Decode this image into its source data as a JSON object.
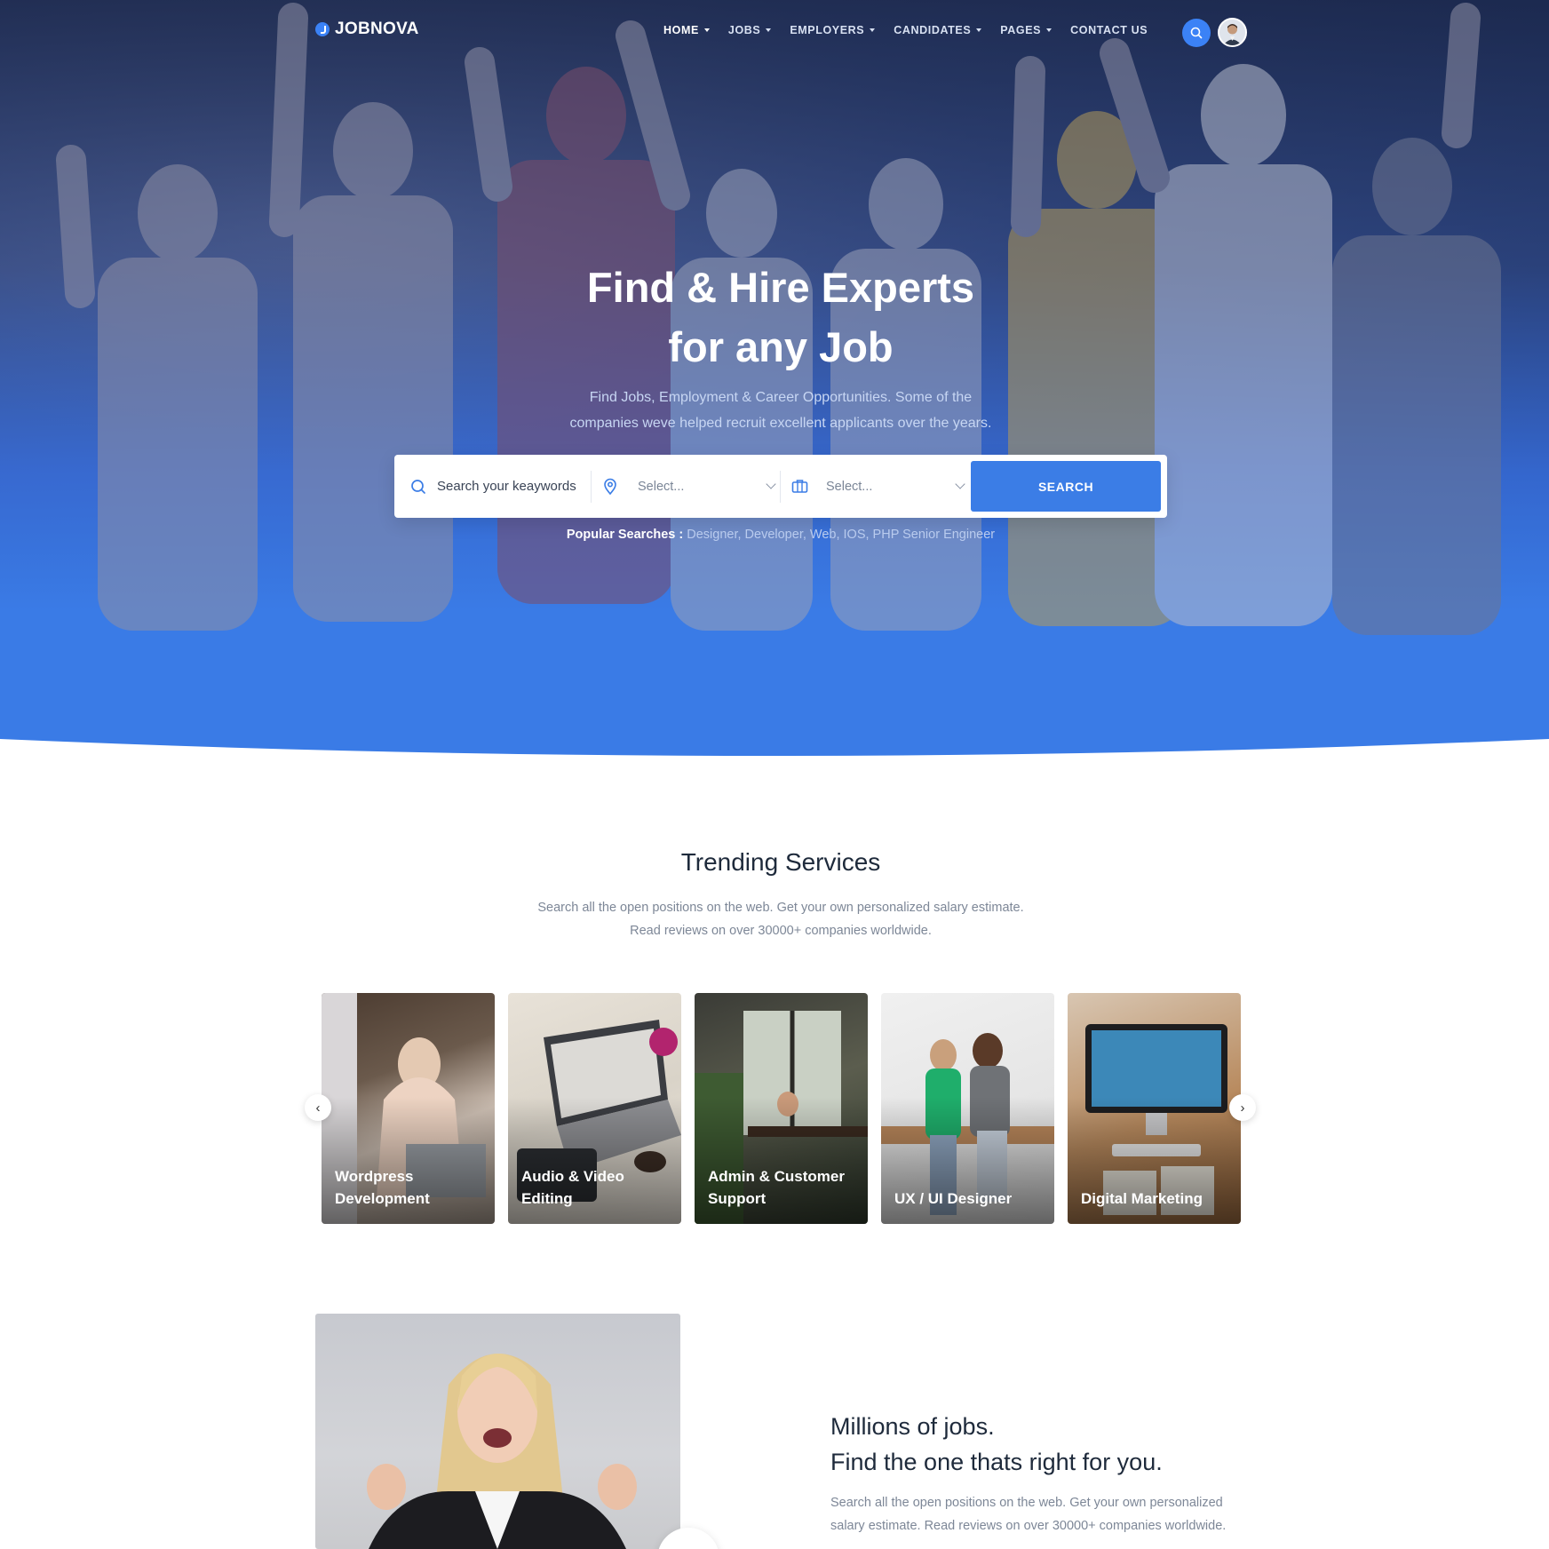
{
  "brand": {
    "name": "JOBNOVA",
    "accent": "#3b7de6"
  },
  "nav": {
    "items": [
      {
        "label": "HOME",
        "has_caret": true
      },
      {
        "label": "JOBS",
        "has_caret": true
      },
      {
        "label": "EMPLOYERS",
        "has_caret": true
      },
      {
        "label": "CANDIDATES",
        "has_caret": true
      },
      {
        "label": "PAGES",
        "has_caret": true
      },
      {
        "label": "CONTACT US",
        "has_caret": false
      }
    ],
    "active": "HOME",
    "search_icon": "search-icon",
    "avatar": "user-avatar"
  },
  "hero": {
    "title_line1": "Find & Hire Experts",
    "title_line2": "for any Job",
    "subtitle_line1": "Find Jobs, Employment & Career Opportunities. Some of the",
    "subtitle_line2": "companies weve helped recruit excellent applicants over the years."
  },
  "search": {
    "keyword_value": "Search your keaywords",
    "location_placeholder": "Select...",
    "category_placeholder": "Select...",
    "button_label": "SEARCH",
    "popular_label": "Popular Searches :",
    "popular_values": "Designer, Developer, Web, IOS, PHP Senior Engineer"
  },
  "trending": {
    "title": "Trending Services",
    "subtitle_line1": "Search all the open positions on the web. Get your own personalized salary estimate.",
    "subtitle_line2": "Read reviews on over 30000+ companies worldwide.",
    "cards": [
      {
        "label": "Wordpress Development"
      },
      {
        "label": "Audio & Video Editing"
      },
      {
        "label": "Admin & Customer Support"
      },
      {
        "label": "UX / UI Designer"
      },
      {
        "label": "Digital Marketing"
      }
    ],
    "prev": "‹",
    "next": "›"
  },
  "millions": {
    "title_line1": "Millions of jobs.",
    "title_line2": "Find the one thats right for you.",
    "subtitle_line1": "Search all the open positions on the web. Get your own personalized",
    "subtitle_line2": "salary estimate. Read reviews on over 30000+ companies worldwide."
  }
}
